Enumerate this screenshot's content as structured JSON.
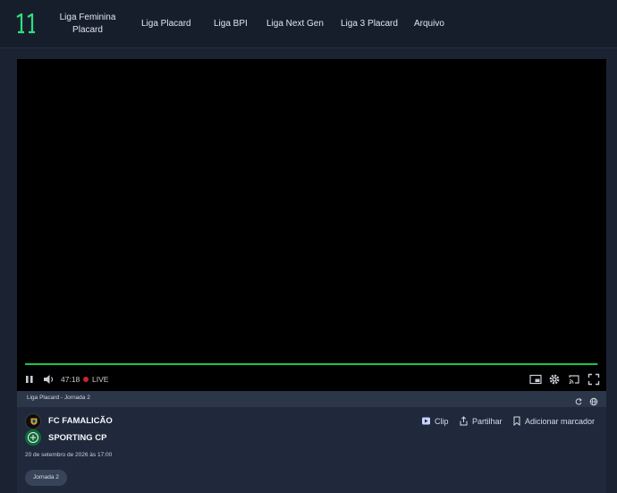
{
  "header": {
    "logo_icon": "eleven-logo-icon",
    "nav": [
      {
        "label": "Liga Feminina Placard"
      },
      {
        "label": "Liga Placard"
      },
      {
        "label": "Liga BPI"
      },
      {
        "label": "Liga Next Gen"
      },
      {
        "label": "Liga 3 Placard"
      },
      {
        "label": "Arquivo"
      }
    ]
  },
  "player": {
    "elapsed": "47:18",
    "live_label": "LIVE",
    "progress_fraction": 0.999,
    "accent_color": "#1ec34a"
  },
  "match": {
    "competition": "Liga Placard - Jornada 2",
    "home_team": "FC FAMALICÃO",
    "away_team": "SPORTING CP",
    "datetime": "20 de setembro de 2026 às 17:00",
    "round_badge": "Jornada 2",
    "actions": {
      "clip": "Clip",
      "share": "Partilhar",
      "bookmark": "Adicionar marcador"
    }
  }
}
